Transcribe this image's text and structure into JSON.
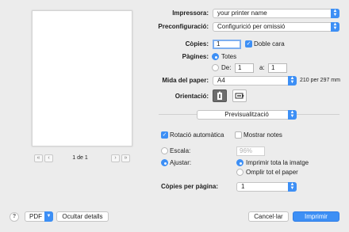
{
  "preview": {
    "nav": {
      "first": "«",
      "prev": "‹",
      "next": "›",
      "last": "»"
    },
    "page_count": "1 de 1"
  },
  "printer": {
    "label": "Impressora:",
    "value": "your printer name"
  },
  "presets": {
    "label": "Preconfiguració:",
    "value": "Configurició per omissió"
  },
  "copies": {
    "label": "Còpies:",
    "value": "1",
    "duplex_label": "Doble cara",
    "duplex_checked": true
  },
  "pages": {
    "label": "Pàgines:",
    "all_label": "Totes",
    "from_label": "De:",
    "from_value": "1",
    "to_label": "a:",
    "to_value": "1"
  },
  "paper": {
    "label": "Mida del paper:",
    "value": "A4",
    "dimensions": "210 per 297 mm"
  },
  "orientation": {
    "label": "Orientació:",
    "selected": "portrait"
  },
  "section": {
    "value": "Previsualització"
  },
  "options": {
    "auto_rotate": {
      "label": "Rotació automàtica",
      "checked": true
    },
    "show_notes": {
      "label": "Mostrar notes",
      "checked": false
    }
  },
  "scale": {
    "scale_label": "Escala:",
    "scale_value": "96%",
    "fit_label": "Ajustar:",
    "print_entire": "Imprimir tota la imatge",
    "fill_paper": "Omplir tot el paper"
  },
  "copies_per_page": {
    "label": "Còpies per pàgina:",
    "value": "1"
  },
  "footer": {
    "help": "?",
    "pdf": "PDF",
    "hide_details": "Ocultar detalls",
    "cancel": "Cancel·lar",
    "print": "Imprimir"
  },
  "colors": {
    "accent": "#3d8ff5",
    "background": "#ececec"
  }
}
